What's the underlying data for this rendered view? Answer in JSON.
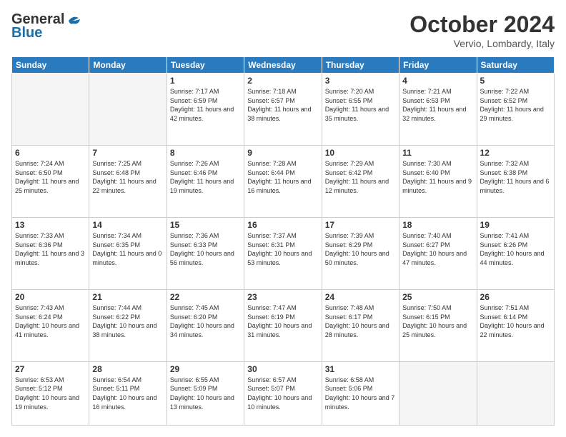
{
  "logo": {
    "line1": "General",
    "line2": "Blue"
  },
  "header": {
    "month": "October 2024",
    "location": "Vervio, Lombardy, Italy"
  },
  "weekdays": [
    "Sunday",
    "Monday",
    "Tuesday",
    "Wednesday",
    "Thursday",
    "Friday",
    "Saturday"
  ],
  "weeks": [
    [
      {
        "day": "",
        "content": ""
      },
      {
        "day": "",
        "content": ""
      },
      {
        "day": "1",
        "content": "Sunrise: 7:17 AM\nSunset: 6:59 PM\nDaylight: 11 hours and 42 minutes."
      },
      {
        "day": "2",
        "content": "Sunrise: 7:18 AM\nSunset: 6:57 PM\nDaylight: 11 hours and 38 minutes."
      },
      {
        "day": "3",
        "content": "Sunrise: 7:20 AM\nSunset: 6:55 PM\nDaylight: 11 hours and 35 minutes."
      },
      {
        "day": "4",
        "content": "Sunrise: 7:21 AM\nSunset: 6:53 PM\nDaylight: 11 hours and 32 minutes."
      },
      {
        "day": "5",
        "content": "Sunrise: 7:22 AM\nSunset: 6:52 PM\nDaylight: 11 hours and 29 minutes."
      }
    ],
    [
      {
        "day": "6",
        "content": "Sunrise: 7:24 AM\nSunset: 6:50 PM\nDaylight: 11 hours and 25 minutes."
      },
      {
        "day": "7",
        "content": "Sunrise: 7:25 AM\nSunset: 6:48 PM\nDaylight: 11 hours and 22 minutes."
      },
      {
        "day": "8",
        "content": "Sunrise: 7:26 AM\nSunset: 6:46 PM\nDaylight: 11 hours and 19 minutes."
      },
      {
        "day": "9",
        "content": "Sunrise: 7:28 AM\nSunset: 6:44 PM\nDaylight: 11 hours and 16 minutes."
      },
      {
        "day": "10",
        "content": "Sunrise: 7:29 AM\nSunset: 6:42 PM\nDaylight: 11 hours and 12 minutes."
      },
      {
        "day": "11",
        "content": "Sunrise: 7:30 AM\nSunset: 6:40 PM\nDaylight: 11 hours and 9 minutes."
      },
      {
        "day": "12",
        "content": "Sunrise: 7:32 AM\nSunset: 6:38 PM\nDaylight: 11 hours and 6 minutes."
      }
    ],
    [
      {
        "day": "13",
        "content": "Sunrise: 7:33 AM\nSunset: 6:36 PM\nDaylight: 11 hours and 3 minutes."
      },
      {
        "day": "14",
        "content": "Sunrise: 7:34 AM\nSunset: 6:35 PM\nDaylight: 11 hours and 0 minutes."
      },
      {
        "day": "15",
        "content": "Sunrise: 7:36 AM\nSunset: 6:33 PM\nDaylight: 10 hours and 56 minutes."
      },
      {
        "day": "16",
        "content": "Sunrise: 7:37 AM\nSunset: 6:31 PM\nDaylight: 10 hours and 53 minutes."
      },
      {
        "day": "17",
        "content": "Sunrise: 7:39 AM\nSunset: 6:29 PM\nDaylight: 10 hours and 50 minutes."
      },
      {
        "day": "18",
        "content": "Sunrise: 7:40 AM\nSunset: 6:27 PM\nDaylight: 10 hours and 47 minutes."
      },
      {
        "day": "19",
        "content": "Sunrise: 7:41 AM\nSunset: 6:26 PM\nDaylight: 10 hours and 44 minutes."
      }
    ],
    [
      {
        "day": "20",
        "content": "Sunrise: 7:43 AM\nSunset: 6:24 PM\nDaylight: 10 hours and 41 minutes."
      },
      {
        "day": "21",
        "content": "Sunrise: 7:44 AM\nSunset: 6:22 PM\nDaylight: 10 hours and 38 minutes."
      },
      {
        "day": "22",
        "content": "Sunrise: 7:45 AM\nSunset: 6:20 PM\nDaylight: 10 hours and 34 minutes."
      },
      {
        "day": "23",
        "content": "Sunrise: 7:47 AM\nSunset: 6:19 PM\nDaylight: 10 hours and 31 minutes."
      },
      {
        "day": "24",
        "content": "Sunrise: 7:48 AM\nSunset: 6:17 PM\nDaylight: 10 hours and 28 minutes."
      },
      {
        "day": "25",
        "content": "Sunrise: 7:50 AM\nSunset: 6:15 PM\nDaylight: 10 hours and 25 minutes."
      },
      {
        "day": "26",
        "content": "Sunrise: 7:51 AM\nSunset: 6:14 PM\nDaylight: 10 hours and 22 minutes."
      }
    ],
    [
      {
        "day": "27",
        "content": "Sunrise: 6:53 AM\nSunset: 5:12 PM\nDaylight: 10 hours and 19 minutes."
      },
      {
        "day": "28",
        "content": "Sunrise: 6:54 AM\nSunset: 5:11 PM\nDaylight: 10 hours and 16 minutes."
      },
      {
        "day": "29",
        "content": "Sunrise: 6:55 AM\nSunset: 5:09 PM\nDaylight: 10 hours and 13 minutes."
      },
      {
        "day": "30",
        "content": "Sunrise: 6:57 AM\nSunset: 5:07 PM\nDaylight: 10 hours and 10 minutes."
      },
      {
        "day": "31",
        "content": "Sunrise: 6:58 AM\nSunset: 5:06 PM\nDaylight: 10 hours and 7 minutes."
      },
      {
        "day": "",
        "content": ""
      },
      {
        "day": "",
        "content": ""
      }
    ]
  ]
}
